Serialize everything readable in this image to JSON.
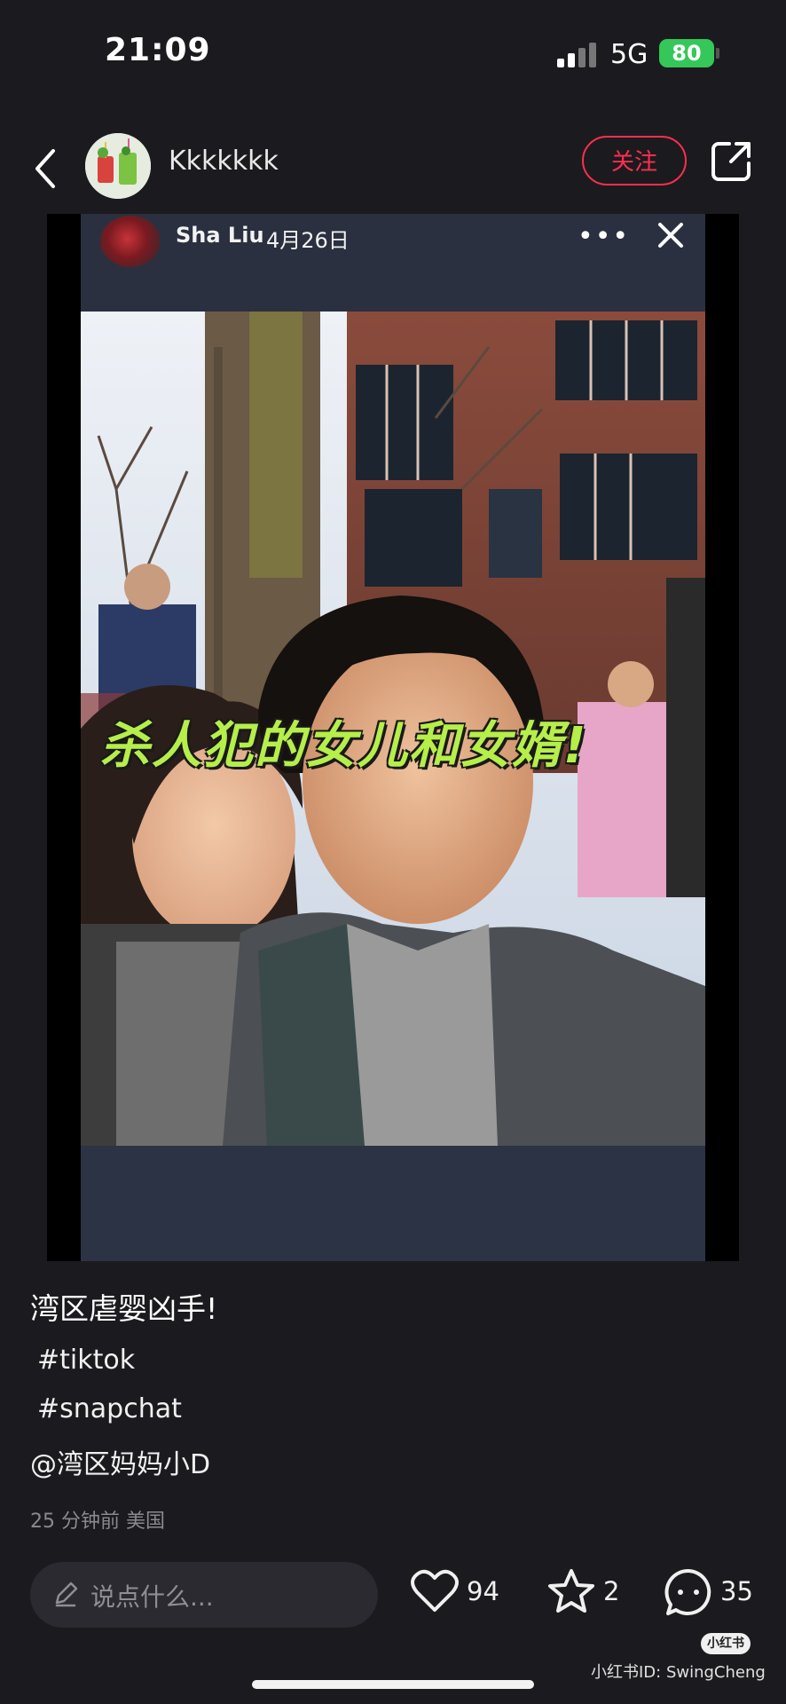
{
  "status_bar": {
    "time": "21:09",
    "network": "5G",
    "battery": "80"
  },
  "header": {
    "username": "Kkkkkkk",
    "follow_label": "关注"
  },
  "post": {
    "embedded_card": {
      "author": "Sha Liu",
      "date": "4月26日",
      "more_label": "•••",
      "overlay_caption": "杀人犯的女儿和女婿!"
    },
    "title": "湾区虐婴凶手!",
    "hashtags": [
      "#tiktok",
      "#snapchat"
    ],
    "mention": "@湾区妈妈小D",
    "meta": "25 分钟前  美国"
  },
  "bottom_bar": {
    "comment_placeholder": "说点什么...",
    "likes": "94",
    "favorites": "2",
    "comments": "35"
  },
  "watermark": {
    "badge": "小红书",
    "text": "小红书ID: SwingCheng"
  },
  "colors": {
    "accent": "#ff2e4d",
    "background": "#1b1b1f",
    "caption": "#b6ee4a",
    "battery": "#35c759"
  }
}
